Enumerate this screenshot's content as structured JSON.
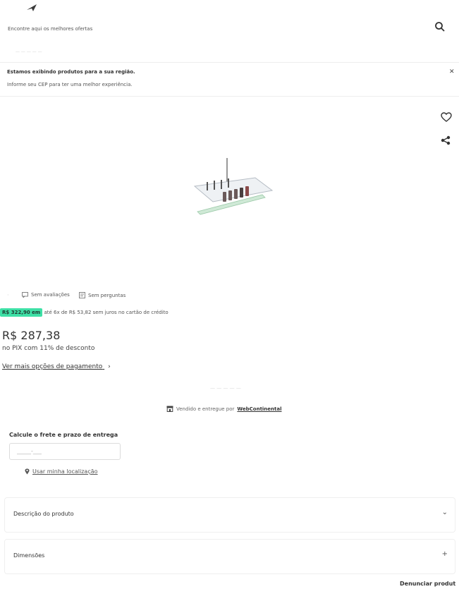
{
  "header": {
    "search_hint": "Encontre aqui os melhores ofertas",
    "icons": {
      "logo": "brand-logo",
      "search": "search-icon"
    }
  },
  "notice": {
    "line1": "Estamos exibindo produtos para a sua região.",
    "line2": "Informe seu CEP para ter uma melhor experiência."
  },
  "product": {
    "reviews": "Sem avaliações",
    "questions": "Sem perguntas",
    "old_price": "R$ 322,90 em",
    "installments_prefix": "até 6x de",
    "installment_value": "R$ 53,82",
    "installments_suffix": "sem juros no cartão de crédito",
    "price": "R$ 287,38",
    "pix_text": "no PIX com 11% de desconto",
    "more_payment": "Ver mais opções de pagamento",
    "sold_by_prefix": "Vendido e entregue por",
    "seller": "WebContinental"
  },
  "freight": {
    "title": "Calcule o frete e prazo de entrega",
    "cep_placeholder": "_____-___",
    "use_location": "Usar minha localização"
  },
  "sections": {
    "description": "Descrição do produto",
    "dimensions": "Dimensões"
  },
  "footer": {
    "report": "Denunciar produt"
  },
  "colors": {
    "price_highlight": "#3ee0a6"
  }
}
